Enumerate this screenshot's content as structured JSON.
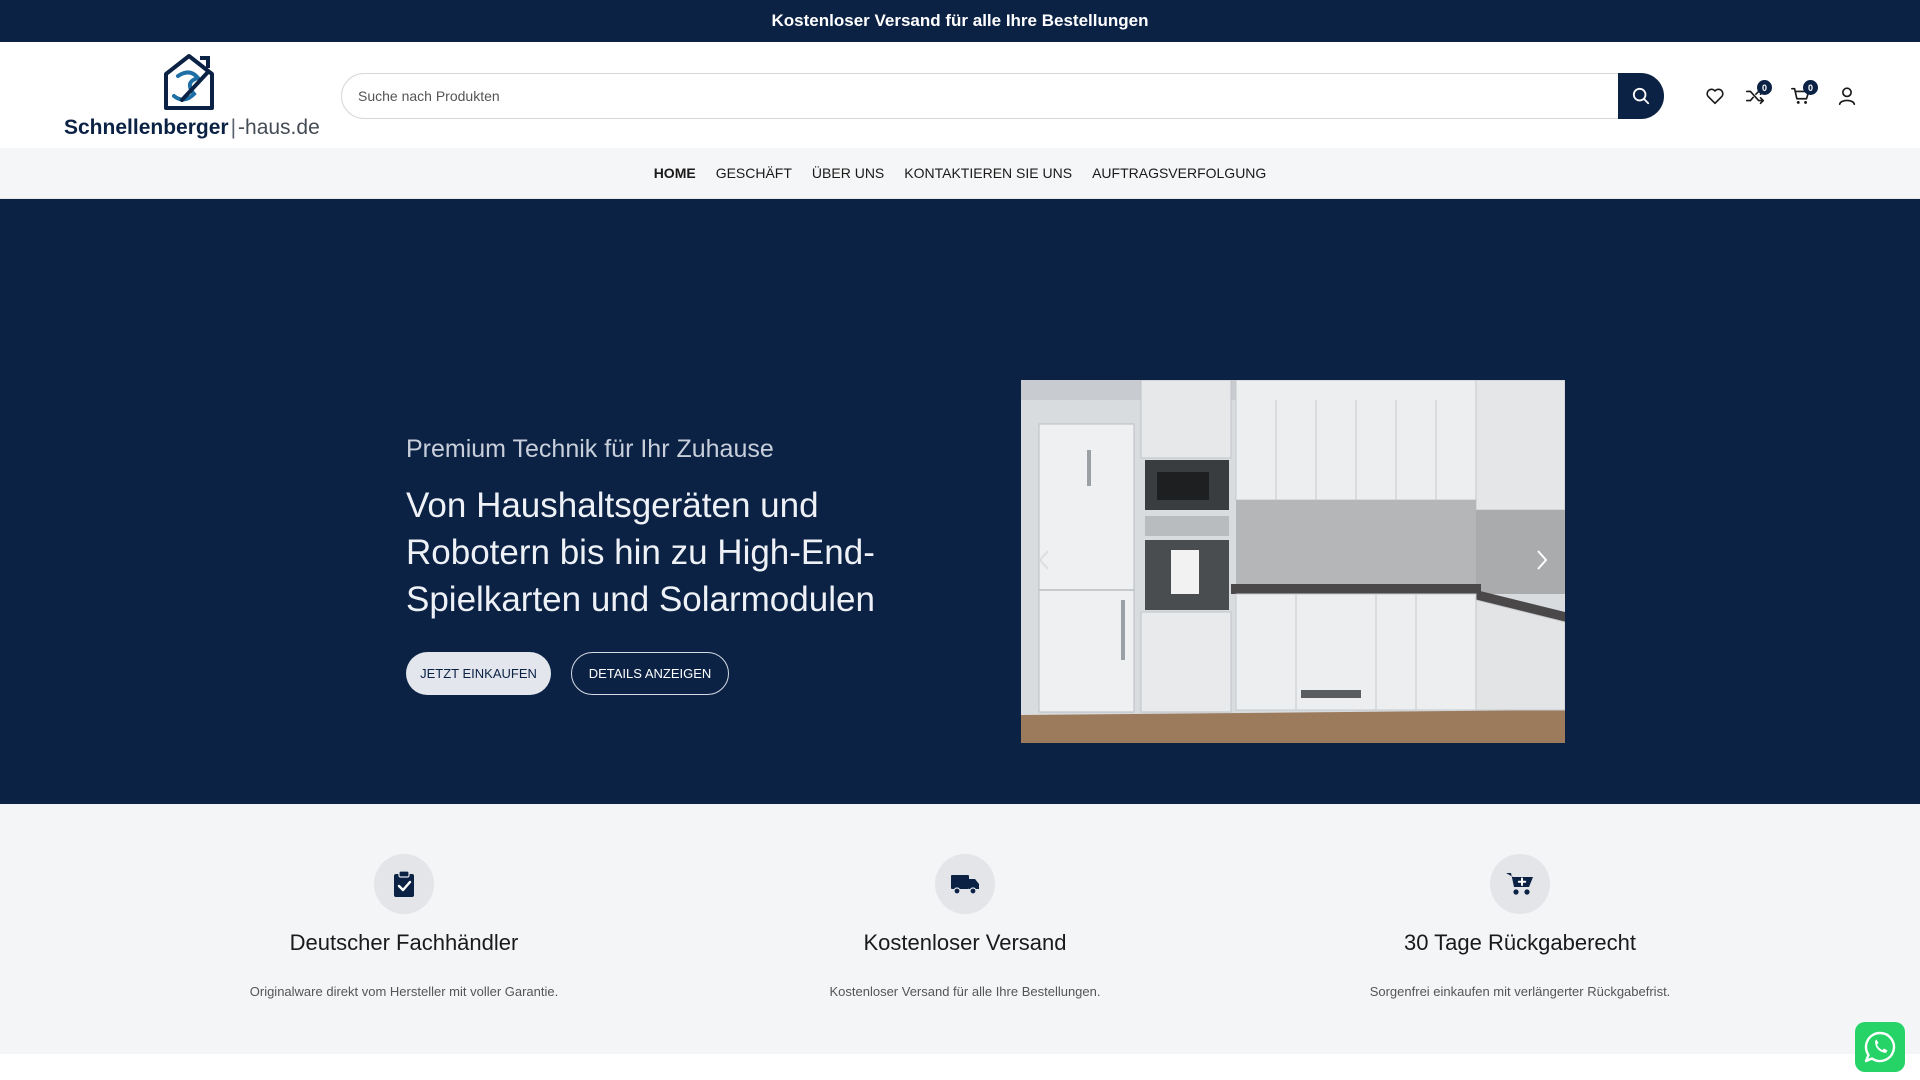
{
  "topbar": {
    "text": "Kostenloser Versand für alle Ihre Bestellungen"
  },
  "header": {
    "logo": {
      "brand": "Schnellenberger",
      "separator": "|",
      "suffix": "-haus.de"
    },
    "search": {
      "placeholder": "Suche nach Produkten",
      "value": ""
    },
    "icons": [
      {
        "name": "wishlist-icon"
      },
      {
        "name": "compare-icon",
        "count": "0"
      },
      {
        "name": "cart-icon",
        "count": "0"
      },
      {
        "name": "account-icon"
      }
    ]
  },
  "nav": {
    "items": [
      {
        "label": "HOME",
        "active": true
      },
      {
        "label": "GESCHÄFT"
      },
      {
        "label": "ÜBER UNS"
      },
      {
        "label": "KONTAKTIEREN SIE UNS"
      },
      {
        "label": "AUFTRAGSVERFOLGUNG"
      }
    ]
  },
  "hero": {
    "subtitle": "Premium Technik für Ihr Zuhause",
    "title": "Von Haushaltsgeräten und Robotern bis hin zu High-End-Spielkarten und Solarmodulen",
    "primary_button": "JETZT EINKAUFEN",
    "secondary_button": "DETAILS ANZEIGEN",
    "slider_image": "kitchen-image"
  },
  "features": [
    {
      "icon": "clipboard-check-icon",
      "title": "Deutscher Fachhändler",
      "desc": "Originalware direkt vom Hersteller mit voller Garantie."
    },
    {
      "icon": "truck-icon",
      "title": "Kostenloser Versand",
      "desc": "Kostenloser Versand für alle Ihre Bestellungen."
    },
    {
      "icon": "cart-plus-icon",
      "title": "30 Tage Rückgaberecht",
      "desc": "Sorgenfrei einkaufen mit verlängerter Rückgabefrist."
    }
  ],
  "colors": {
    "navy": "#0b2245",
    "whatsapp": "#25d366"
  }
}
